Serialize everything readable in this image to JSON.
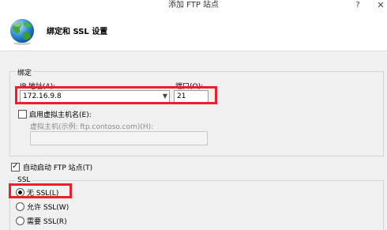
{
  "window": {
    "title": "添加 FTP 站点",
    "help_glyph": "?",
    "close_glyph": "✕"
  },
  "header": {
    "title": "绑定和 SSL 设置",
    "icon": "globe-icon"
  },
  "binding": {
    "group_label": "绑定",
    "ip_label": "IP 地址(A):",
    "ip_value": "172.16.9.8",
    "port_label": "端口(O):",
    "port_value": "21",
    "enable_virtual_host_label": "启用虚拟主机名(E):",
    "enable_virtual_host_checked": false,
    "virtual_host_label": "虚拟主机(示例: ftp.contoso.com)(H):",
    "virtual_host_value": ""
  },
  "auto_start": {
    "label": "自动启动 FTP 站点(T)",
    "checked": true
  },
  "ssl": {
    "group_label": "SSL",
    "options": [
      {
        "label": "无 SSL(L)",
        "selected": true
      },
      {
        "label": "允许 SSL(W)",
        "selected": false
      },
      {
        "label": "需要 SSL(R)",
        "selected": false
      }
    ]
  },
  "colors": {
    "highlight": "#e8202a",
    "background": "#f0f0f0"
  }
}
